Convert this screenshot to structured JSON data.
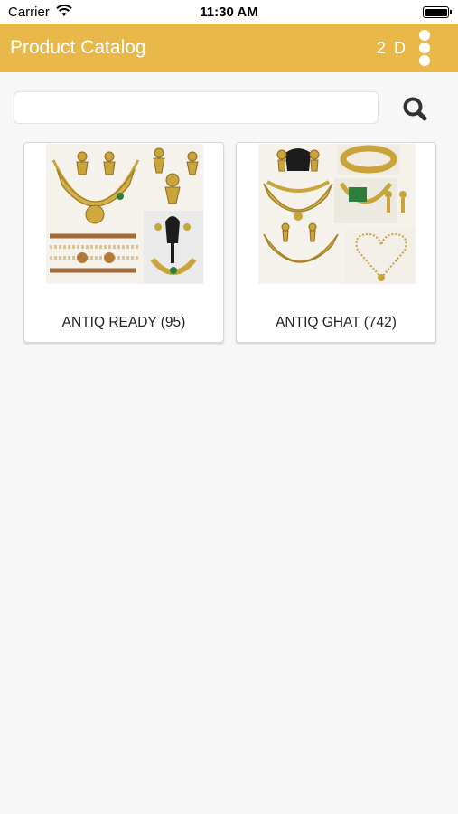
{
  "status_bar": {
    "carrier": "Carrier",
    "time": "11:30 AM"
  },
  "header": {
    "title": "Product Catalog",
    "badge": "2 D",
    "background": "#e8b94a"
  },
  "search": {
    "placeholder": "",
    "value": "",
    "icon": "search-icon"
  },
  "categories": [
    {
      "label": "ANTIQ READY (95)",
      "image": "gold-jewellery-collage"
    },
    {
      "label": "ANTIQ GHAT (742)",
      "image": "gold-jewellery-collage"
    }
  ]
}
